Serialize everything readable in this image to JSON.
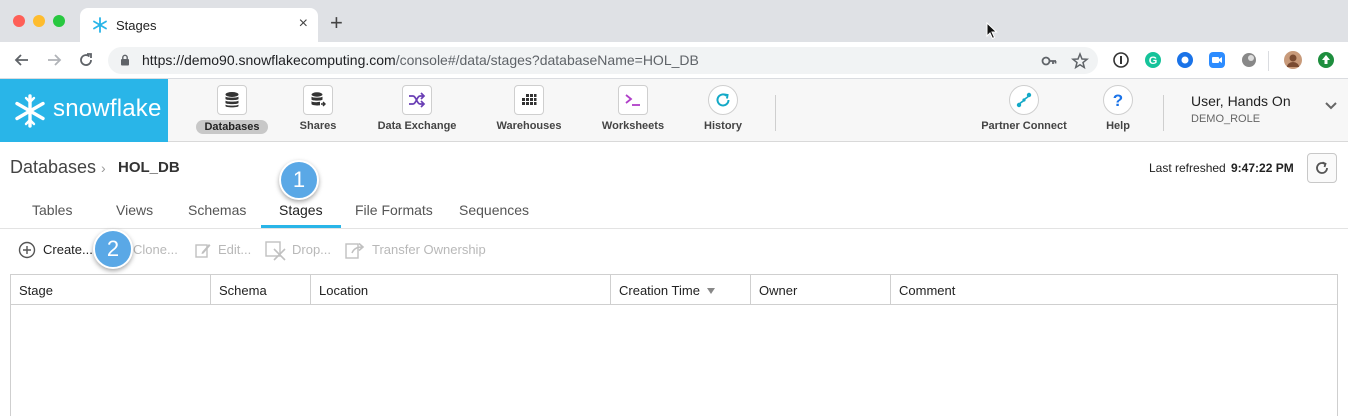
{
  "browser": {
    "tab_title": "Stages",
    "url_host": "https://demo90.snowflakecomputing.com",
    "url_path": "/console#/data/stages?databaseName=HOL_DB"
  },
  "header": {
    "logo_text": "snowflake",
    "nav": [
      {
        "label": "Databases",
        "icon": "database-icon"
      },
      {
        "label": "Shares",
        "icon": "shares-icon"
      },
      {
        "label": "Data Exchange",
        "icon": "data-exchange-icon"
      },
      {
        "label": "Warehouses",
        "icon": "warehouses-icon"
      },
      {
        "label": "Worksheets",
        "icon": "worksheets-icon"
      },
      {
        "label": "History",
        "icon": "history-icon"
      }
    ],
    "partner_connect": "Partner Connect",
    "help": "Help",
    "user_name": "User, Hands On",
    "user_role": "DEMO_ROLE"
  },
  "page": {
    "breadcrumb_root": "Databases",
    "breadcrumb_db": "HOL_DB",
    "last_refreshed_label": "Last refreshed",
    "last_refreshed_time": "9:47:22 PM",
    "tabs": [
      "Tables",
      "Views",
      "Schemas",
      "Stages",
      "File Formats",
      "Sequences"
    ],
    "active_tab": "Stages",
    "actions": {
      "create": "Create...",
      "clone": "Clone...",
      "edit": "Edit...",
      "drop": "Drop...",
      "transfer": "Transfer Ownership"
    },
    "columns": [
      "Stage",
      "Schema",
      "Location",
      "Creation Time",
      "Owner",
      "Comment"
    ],
    "badges": [
      "1",
      "2"
    ]
  },
  "colors": {
    "brand": "#29b5e8",
    "badge": "#5aa8e6"
  }
}
